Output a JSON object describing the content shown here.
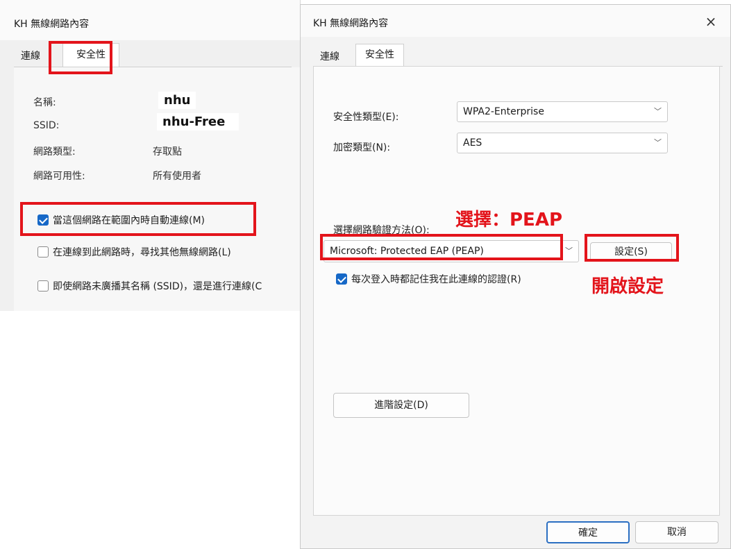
{
  "left_dialog": {
    "title": "KH 無線網路內容",
    "tabs": {
      "connection": "連線",
      "security": "安全性"
    },
    "fields": [
      {
        "label": "名稱:",
        "value": ""
      },
      {
        "label": "SSID:",
        "value": ""
      },
      {
        "label": "網路類型:",
        "value": "存取點"
      },
      {
        "label": "網路可用性:",
        "value": "所有使用者"
      }
    ],
    "overlay_name": "nhu",
    "overlay_ssid": "nhu-Free",
    "checkboxes": [
      {
        "label": "當這個網路在範圍內時自動連線(M)",
        "checked": true
      },
      {
        "label": "在連線到此網路時，尋找其他無線網路(L)",
        "checked": false
      },
      {
        "label": "即使網路未廣播其名稱 (SSID)，還是進行連線(C",
        "checked": false
      }
    ]
  },
  "right_dialog": {
    "title": "KH 無線網路內容",
    "close_icon": "×",
    "tabs": {
      "connection": "連線",
      "security": "安全性"
    },
    "security_type_label": "安全性類型(E):",
    "security_type_value": "WPA2-Enterprise",
    "encryption_type_label": "加密類型(N):",
    "encryption_type_value": "AES",
    "auth_method_label": "選擇網路驗證方法(O):",
    "auth_method_value": "Microsoft: Protected EAP (PEAP)",
    "settings_button": "設定(S)",
    "remember_credentials_label": "每次登入時都記住我在此連線的認證(R)",
    "remember_credentials_checked": true,
    "advanced_button": "進階設定(D)",
    "ok_button": "確定",
    "cancel_button": "取消",
    "chevron_glyph": "﹀"
  },
  "annotations": {
    "select_peap": "選擇：PEAP",
    "open_settings": "開啟設定"
  },
  "colors": {
    "highlight_red": "#e3141b",
    "checkbox_blue": "#1668c7"
  }
}
